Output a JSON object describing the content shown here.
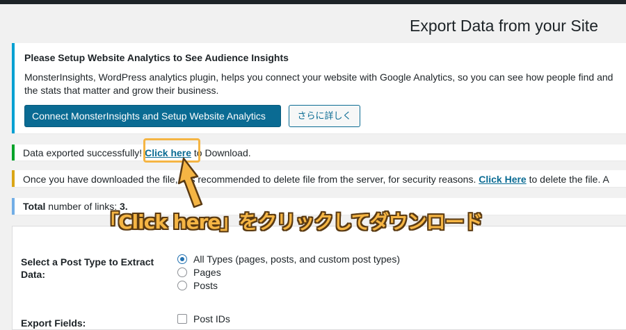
{
  "page": {
    "title": "Export Data from your Site"
  },
  "analytics_notice": {
    "heading": "Please Setup Website Analytics to See Audience Insights",
    "line1": "MonsterInsights, WordPress analytics plugin, helps you connect your website with Google Analytics, so you can see how people find and",
    "line2": "the stats that matter and grow their business.",
    "primary_button": "Connect MonsterInsights and Setup Website Analytics",
    "secondary_button": "さらに詳しく"
  },
  "success_notice": {
    "before": "Data exported successfully! ",
    "link": "Click here",
    "after": " to Download."
  },
  "warning_notice": {
    "before": "Once you have downloaded the file, it is recommended to delete file from the server, for security reasons. ",
    "link": "Click Here",
    "after": " to delete the file. A"
  },
  "info_notice": {
    "label": "Total",
    "text": " number of links: ",
    "count": "3."
  },
  "form": {
    "post_type_label": "Select a Post Type to Extract Data:",
    "post_type_options": [
      {
        "label": "All Types (pages, posts, and custom post types)",
        "checked": true
      },
      {
        "label": "Pages",
        "checked": false
      },
      {
        "label": "Posts",
        "checked": false
      }
    ],
    "export_fields_label": "Export Fields:",
    "export_fields": [
      {
        "label": "Post IDs",
        "checked": false
      }
    ]
  },
  "annotation": {
    "caption": "「Click here」をクリックしてダウンロード",
    "accent_color": "#f5b544"
  }
}
